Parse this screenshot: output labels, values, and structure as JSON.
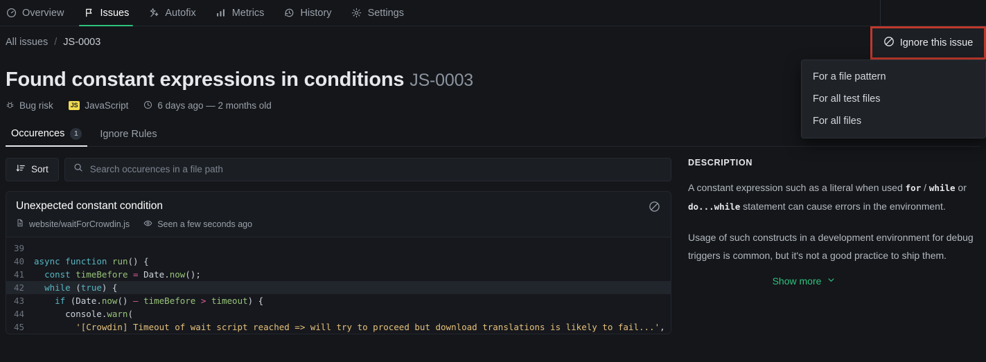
{
  "nav": {
    "tabs": [
      {
        "label": "Overview",
        "icon": "gauge-icon",
        "active": false
      },
      {
        "label": "Issues",
        "icon": "flag-icon",
        "active": true
      },
      {
        "label": "Autofix",
        "icon": "sparkle-icon",
        "active": false
      },
      {
        "label": "Metrics",
        "icon": "bar-chart-icon",
        "active": false
      },
      {
        "label": "History",
        "icon": "history-icon",
        "active": false
      },
      {
        "label": "Settings",
        "icon": "gear-icon",
        "active": false
      }
    ]
  },
  "breadcrumb": {
    "root": "All issues",
    "separator": "/",
    "current": "JS-0003"
  },
  "ignore": {
    "button_label": "Ignore this issue",
    "button_icon": "ban-icon",
    "menu": [
      {
        "label": "For a file pattern"
      },
      {
        "label": "For all test files"
      },
      {
        "label": "For all files"
      }
    ]
  },
  "issue": {
    "title": "Found constant expressions in conditions",
    "code": "JS-0003",
    "category": "Bug risk",
    "category_icon": "bug-icon",
    "language": "JavaScript",
    "language_badge": "JS",
    "age_icon": "clock-icon",
    "age": "6 days ago — 2 months old"
  },
  "subtabs": [
    {
      "label": "Occurences",
      "count": "1",
      "active": true
    },
    {
      "label": "Ignore Rules",
      "count": "",
      "active": false
    }
  ],
  "toolbar": {
    "sort_label": "Sort",
    "sort_icon": "sort-desc-icon",
    "search_icon": "search-icon",
    "search_placeholder": "Search occurences in a file path",
    "search_value": ""
  },
  "occurrence": {
    "title": "Unexpected constant condition",
    "file_icon": "file-icon",
    "file": "website/waitForCrowdin.js",
    "seen_icon": "eye-icon",
    "seen": "Seen a few seconds ago",
    "ignore_icon": "ban-icon",
    "lines": [
      {
        "no": "39",
        "highlight": false,
        "tokens": []
      },
      {
        "no": "40",
        "highlight": false,
        "tokens": [
          {
            "t": "async",
            "c": "kw"
          },
          {
            "t": " ",
            "c": "pl"
          },
          {
            "t": "function",
            "c": "kw"
          },
          {
            "t": " ",
            "c": "pl"
          },
          {
            "t": "run",
            "c": "fn"
          },
          {
            "t": "() {",
            "c": "pl"
          }
        ]
      },
      {
        "no": "41",
        "highlight": false,
        "tokens": [
          {
            "t": "  ",
            "c": "pl"
          },
          {
            "t": "const",
            "c": "kw"
          },
          {
            "t": " ",
            "c": "pl"
          },
          {
            "t": "timeBefore",
            "c": "id"
          },
          {
            "t": " ",
            "c": "pl"
          },
          {
            "t": "=",
            "c": "op"
          },
          {
            "t": " Date.",
            "c": "pl"
          },
          {
            "t": "now",
            "c": "fn"
          },
          {
            "t": "();",
            "c": "pl"
          }
        ]
      },
      {
        "no": "42",
        "highlight": true,
        "tokens": [
          {
            "t": "  ",
            "c": "pl"
          },
          {
            "t": "while",
            "c": "kw"
          },
          {
            "t": " (",
            "c": "pl"
          },
          {
            "t": "true",
            "c": "kw"
          },
          {
            "t": ") {",
            "c": "pl"
          }
        ]
      },
      {
        "no": "43",
        "highlight": false,
        "tokens": [
          {
            "t": "    ",
            "c": "pl"
          },
          {
            "t": "if",
            "c": "kw"
          },
          {
            "t": " (Date.",
            "c": "pl"
          },
          {
            "t": "now",
            "c": "fn"
          },
          {
            "t": "() ",
            "c": "pl"
          },
          {
            "t": "—",
            "c": "op"
          },
          {
            "t": " ",
            "c": "pl"
          },
          {
            "t": "timeBefore",
            "c": "id"
          },
          {
            "t": " ",
            "c": "pl"
          },
          {
            "t": ">",
            "c": "op"
          },
          {
            "t": " ",
            "c": "pl"
          },
          {
            "t": "timeout",
            "c": "id"
          },
          {
            "t": ") {",
            "c": "pl"
          }
        ]
      },
      {
        "no": "44",
        "highlight": false,
        "tokens": [
          {
            "t": "      console.",
            "c": "pl"
          },
          {
            "t": "warn",
            "c": "fn"
          },
          {
            "t": "(",
            "c": "pl"
          }
        ]
      },
      {
        "no": "45",
        "highlight": false,
        "tokens": [
          {
            "t": "        ",
            "c": "pl"
          },
          {
            "t": "'[Crowdin] Timeout of wait script reached => will try to proceed but download translations is likely to fail...'",
            "c": "str"
          },
          {
            "t": ",",
            "c": "pl"
          }
        ]
      }
    ]
  },
  "description": {
    "heading": "DESCRIPTION",
    "p1_a": "A constant expression such as a literal when used ",
    "p1_code1": "for",
    "p1_b": " / ",
    "p1_code2": "while",
    "p1_c": " or ",
    "p1_code3": "do...while",
    "p1_d": " statement can cause errors in the environment.",
    "p2": "Usage of such constructs in a development environment for debug triggers is common, but it's not a good practice to ship them.",
    "show_more": "Show more",
    "show_more_icon": "chevron-down-icon"
  },
  "colors": {
    "page_bg": "#141619",
    "card_bg": "#181b20",
    "accent_green": "#2ec27e",
    "highlight_red": "#c0392b",
    "js_yellow": "#f0db4f"
  }
}
